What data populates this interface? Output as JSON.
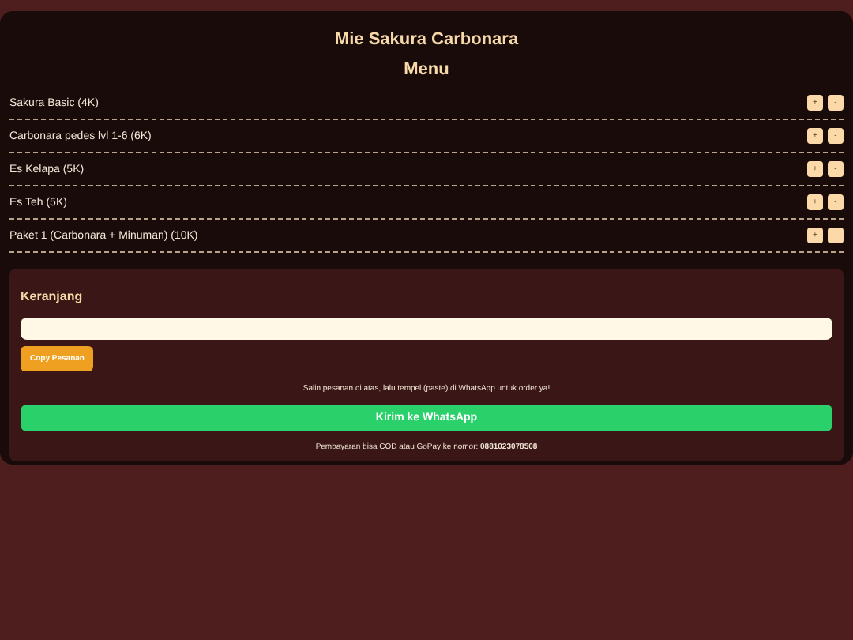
{
  "title": "Mie Sakura Carbonara",
  "menu_heading": "Menu",
  "menu_items": [
    {
      "name": "Sakura Basic (4K)",
      "add": "+",
      "remove": "-"
    },
    {
      "name": "Carbonara pedes lvl 1-6 (6K)",
      "add": "+",
      "remove": "-"
    },
    {
      "name": "Es Kelapa (5K)",
      "add": "+",
      "remove": "-"
    },
    {
      "name": "Es Teh (5K)",
      "add": "+",
      "remove": "-"
    },
    {
      "name": "Paket 1 (Carbonara + Minuman) (10K)",
      "add": "+",
      "remove": "-"
    }
  ],
  "cart": {
    "heading": "Keranjang",
    "copy_button": "Copy Pesanan",
    "hint": "Salin pesanan di atas, lalu tempel (paste) di WhatsApp untuk order ya!",
    "send_button": "Kirim ke WhatsApp",
    "payment_note": "Pembayaran bisa COD atau GoPay ke nomor: **0881023078508**"
  }
}
